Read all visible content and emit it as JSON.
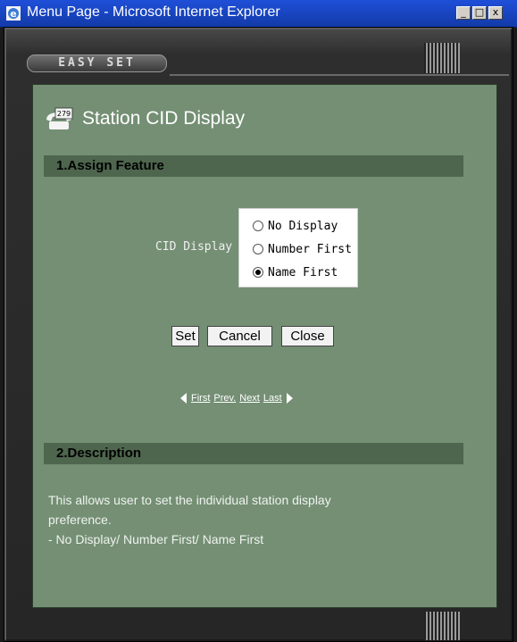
{
  "window": {
    "title": "Menu Page - Microsoft Internet Explorer",
    "minimize": "_",
    "maximize": "□",
    "close": "x"
  },
  "brand": {
    "label": "EASY SET"
  },
  "page": {
    "icon_number": "279",
    "title": "Station CID Display"
  },
  "section1": {
    "title": "1.Assign Feature"
  },
  "cid": {
    "label": "CID Display",
    "options": [
      {
        "label": "No Display",
        "checked": false
      },
      {
        "label": "Number First",
        "checked": false
      },
      {
        "label": "Name First",
        "checked": true
      }
    ]
  },
  "buttons": {
    "set": "Set",
    "cancel": "Cancel",
    "close": "Close"
  },
  "pager": {
    "first": "First",
    "prev": "Prev.",
    "next": "Next",
    "last": "Last"
  },
  "section2": {
    "title": "2.Description"
  },
  "description": {
    "line1": "This allows user to set the individual station display",
    "line2": "preference.",
    "line3": "- No Display/ Number First/ Name First"
  }
}
